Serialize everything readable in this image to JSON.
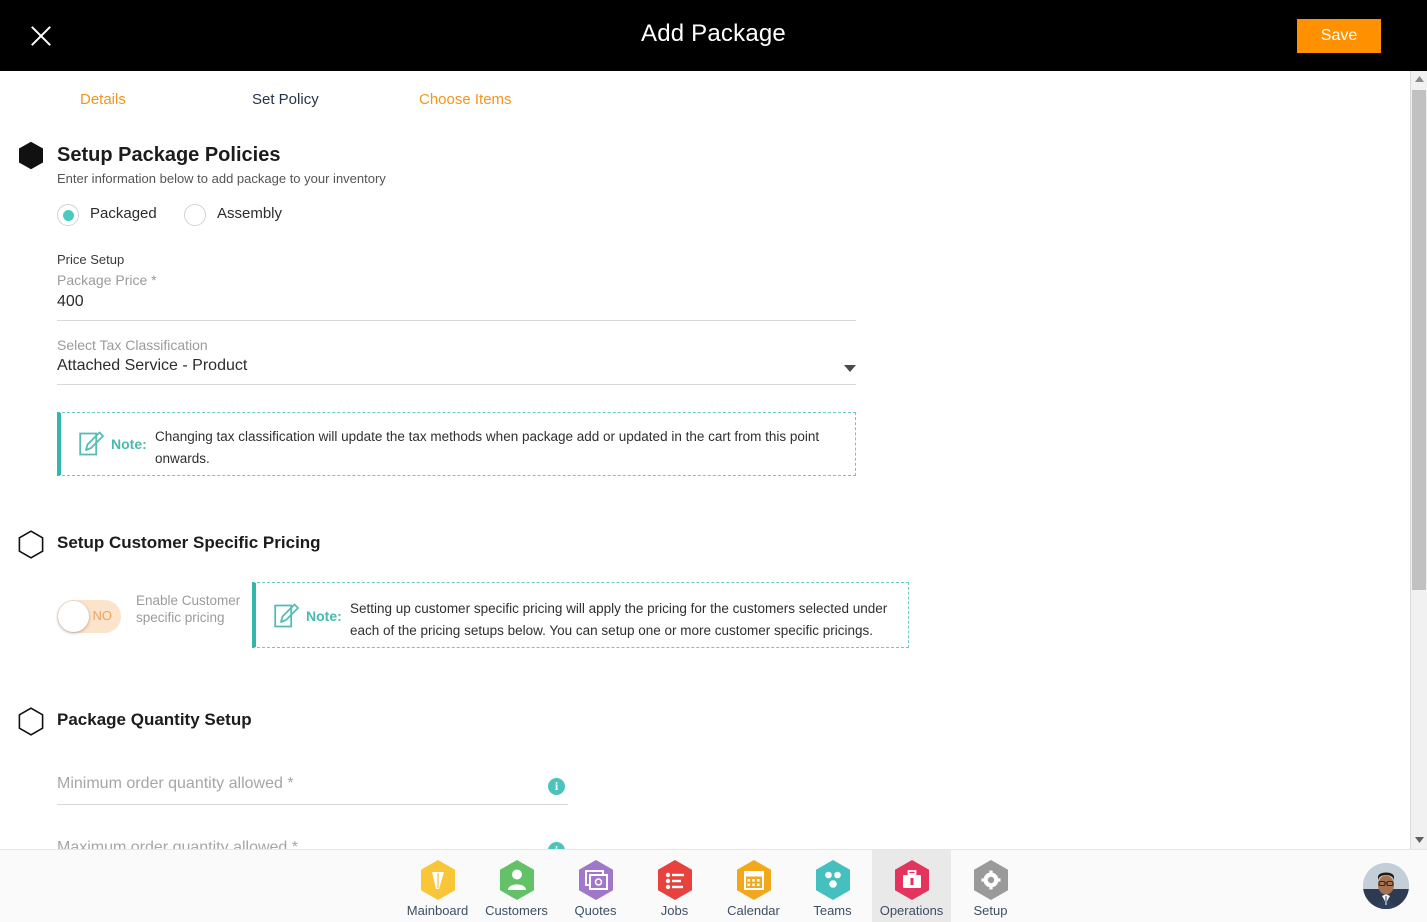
{
  "topbar": {
    "title": "Add Package",
    "close_label": "×",
    "save_label": "Save"
  },
  "tabs": [
    {
      "label": "Details",
      "active": false
    },
    {
      "label": "Set Policy",
      "active": true
    },
    {
      "label": "Choose Items",
      "active": false
    }
  ],
  "sections": {
    "package_policies": {
      "title": "Setup Package Policies",
      "subtitle": "Enter information below to add package to your inventory",
      "radios": [
        {
          "label": "Packaged",
          "selected": true
        },
        {
          "label": "Assembly",
          "selected": false
        }
      ],
      "price_setup_title": "Price Setup",
      "package_price_label": "Package Price *",
      "package_price_value": "400",
      "tax_classification_label": "Select Tax Classification",
      "tax_classification_value": "Attached Service - Product",
      "note_word": "Note:",
      "note_text": "Changing tax classification will update the tax methods when package add or updated in the cart from this point onwards."
    },
    "customer_pricing": {
      "title": "Setup Customer Specific Pricing",
      "toggle_value": "NO",
      "toggle_label": "Enable Customer specific pricing",
      "note_word": "Note:",
      "note_text": "Setting up customer specific pricing will apply the pricing for the customers selected under each of the pricing setups below. You can setup one or more customer specific pricings."
    },
    "quantity_setup": {
      "title": "Package Quantity Setup",
      "min_qty_placeholder": "Minimum order quantity allowed *",
      "max_qty_placeholder": "Maximum order quantity allowed *",
      "info_tooltip": "i"
    }
  },
  "bottom_nav": [
    {
      "label": "Mainboard",
      "icon": "mainboard-icon",
      "color": "#f8c636",
      "active": false
    },
    {
      "label": "Customers",
      "icon": "customers-icon",
      "color": "#63c267",
      "active": false
    },
    {
      "label": "Quotes",
      "icon": "quotes-icon",
      "color": "#a077cb",
      "active": false
    },
    {
      "label": "Jobs",
      "icon": "jobs-icon",
      "color": "#e8423f",
      "active": false
    },
    {
      "label": "Calendar",
      "icon": "calendar-icon",
      "color": "#f2a81d",
      "active": false
    },
    {
      "label": "Teams",
      "icon": "teams-icon",
      "color": "#45c0bf",
      "active": false
    },
    {
      "label": "Operations",
      "icon": "operations-icon",
      "color": "#e4335c",
      "active": true
    },
    {
      "label": "Setup",
      "icon": "setup-icon",
      "color": "#9a9a9a",
      "active": false
    }
  ],
  "colors": {
    "accent_orange": "#ff9100",
    "accent_teal": "#4ec3bd",
    "tab_active": "#24344d",
    "note_border": "#34b6ad"
  },
  "scrollbar": {
    "up_arrow": "▲",
    "down_arrow": "▼"
  }
}
